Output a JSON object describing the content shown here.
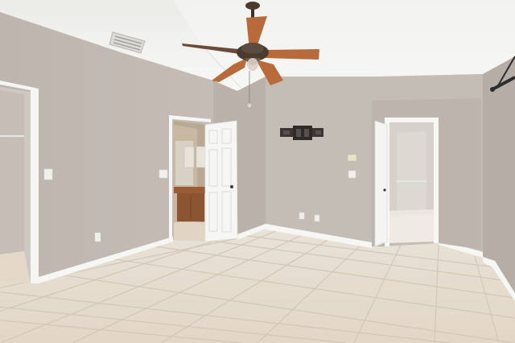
{
  "palette": {
    "ceiling": "#f2f2f0",
    "wall_main": "#c2bab3",
    "wall_shadow": "#aea69f",
    "wall_light": "#cbc5be",
    "trim": "#f7f7f5",
    "floor": "#e6dccd",
    "floor_grout": "#cfc3b2",
    "fan_wood": "#b86a3a",
    "fan_metal": "#4a3a30",
    "cabinet": "#8a5530"
  }
}
